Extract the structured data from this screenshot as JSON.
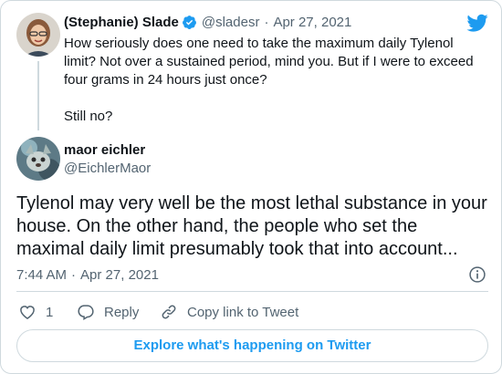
{
  "quoted": {
    "display_name": "(Stephanie) Slade",
    "handle": "@sladesr",
    "separator": "·",
    "date": "Apr 27, 2021",
    "text_lines": [
      "How seriously does one need to take the maximum daily Tylenol",
      "limit? Not over a sustained period, mind you. But if I were to exceed",
      "four grams in 24 hours just once?"
    ],
    "text_last": "Still no?"
  },
  "reply": {
    "display_name": "maor eichler",
    "handle": "@EichlerMaor",
    "text": "Tylenol may very well be the most lethal substance in your house. On the other hand, the people who set the maximal daily limit presumably took that into account...",
    "time": "7:44 AM",
    "separator": "·",
    "date": "Apr 27, 2021"
  },
  "actions": {
    "like_count": "1",
    "reply_label": "Reply",
    "copy_label": "Copy link to Tweet"
  },
  "explore_label": "Explore what's happening on Twitter",
  "colors": {
    "accent": "#1d9bf0",
    "text": "#0f1419",
    "muted": "#536471",
    "border": "#cfd9de"
  },
  "icons": [
    "twitter-bird-icon",
    "verified-badge-icon",
    "info-icon",
    "heart-icon",
    "reply-icon",
    "link-icon"
  ]
}
